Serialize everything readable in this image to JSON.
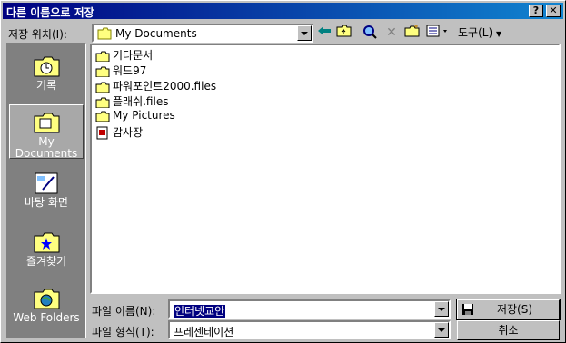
{
  "window": {
    "title": "다른 이름으로 저장",
    "help_glyph": "?",
    "close_glyph": "✕"
  },
  "location": {
    "label": "저장 위치(I):",
    "value": "My Documents"
  },
  "toolbar": {
    "tools_label": "도구(L)"
  },
  "places": [
    {
      "label": "기록",
      "icon": "history-icon"
    },
    {
      "label": "My Documents",
      "icon": "my-documents-icon"
    },
    {
      "label": "바탕 화면",
      "icon": "desktop-icon"
    },
    {
      "label": "즐겨찾기",
      "icon": "favorites-icon"
    },
    {
      "label": "Web Folders",
      "icon": "web-folders-icon"
    }
  ],
  "files": [
    {
      "name": "기타문서",
      "type": "folder"
    },
    {
      "name": "워드97",
      "type": "folder"
    },
    {
      "name": "파워포인트2000.files",
      "type": "folder"
    },
    {
      "name": "플래쉬.files",
      "type": "folder"
    },
    {
      "name": "My Pictures",
      "type": "folder"
    },
    {
      "name": "감사장",
      "type": "presentation"
    }
  ],
  "filename": {
    "label": "파일 이름(N):",
    "value": "인터넷교안"
  },
  "filetype": {
    "label": "파일 형식(T):",
    "value": "프레젠테이션"
  },
  "buttons": {
    "save": "저장(S)",
    "cancel": "취소"
  },
  "colors": {
    "titlebar": "#000080",
    "face": "#c0c0c0",
    "selection": "#000080"
  }
}
